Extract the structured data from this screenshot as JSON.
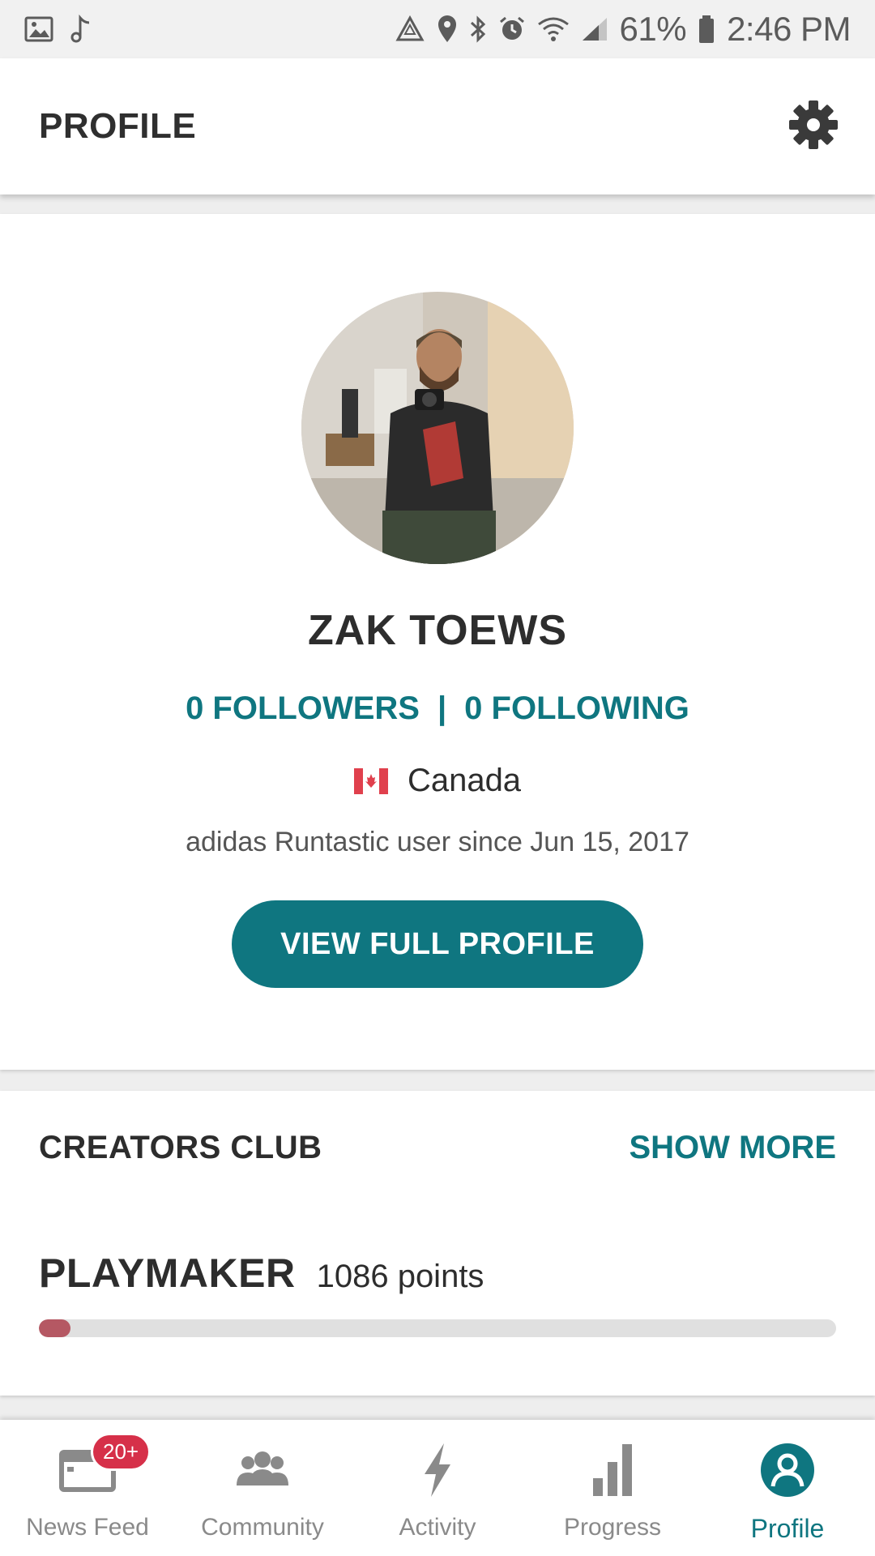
{
  "status_bar": {
    "battery": "61%",
    "time": "2:46 PM",
    "left_icons": [
      "image-icon",
      "music-note-icon"
    ],
    "right_icons": [
      "recycle-icon",
      "location-icon",
      "bluetooth-icon",
      "alarm-icon",
      "wifi-icon",
      "signal-icon",
      "battery-icon"
    ]
  },
  "app_bar": {
    "title": "PROFILE",
    "settings_icon": "gear-icon"
  },
  "profile": {
    "name": "ZAK TOEWS",
    "followers": "0 FOLLOWERS",
    "separator": "|",
    "following": "0 FOLLOWING",
    "country": "Canada",
    "member_since": "adidas Runtastic user since Jun 15, 2017",
    "view_button": "VIEW FULL PROFILE"
  },
  "creators_club": {
    "title": "CREATORS CLUB",
    "show_more": "SHOW MORE",
    "level": "PLAYMAKER",
    "points": "1086 points",
    "progress_fraction": 0.04
  },
  "bottom_nav": {
    "items": [
      {
        "label": "News Feed",
        "icon": "news-feed-icon",
        "badge": "20+"
      },
      {
        "label": "Community",
        "icon": "community-icon"
      },
      {
        "label": "Activity",
        "icon": "activity-bolt-icon"
      },
      {
        "label": "Progress",
        "icon": "progress-bars-icon"
      },
      {
        "label": "Profile",
        "icon": "profile-icon",
        "active": true
      }
    ]
  },
  "colors": {
    "accent": "#0f7680",
    "badge": "#d63049",
    "progress": "#b55863"
  }
}
